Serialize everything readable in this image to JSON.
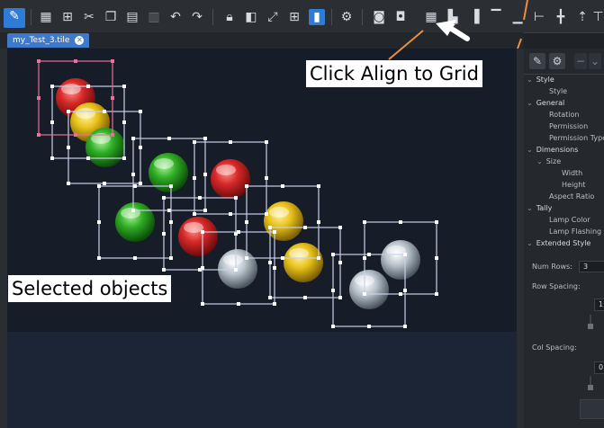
{
  "toolbar": {
    "tools": [
      "pen-edit-icon",
      "grid-large-icon",
      "grid-small-icon",
      "scissors-cut-icon",
      "copy-icon",
      "paste-icon",
      "delete-icon",
      "undo-icon",
      "redo-icon",
      "lock-icon",
      "unlock-icon",
      "resize-icon",
      "table-grid-icon",
      "align-bar-icon",
      "gear-icon",
      "snapshot-icon",
      "snapshot-alt-icon",
      "align-to-grid-icon",
      "align-bottom-left-icon",
      "align-right-icon",
      "align-top-icon",
      "align-bottom-icon",
      "distribute-horizontal-icon",
      "align-upload-icon",
      "distribute-icon"
    ]
  },
  "tab": {
    "label": "my_Test_3.tile",
    "close_icon": "close-icon"
  },
  "panel": {
    "tree": [
      {
        "label": "Style",
        "level": 0,
        "expanded": true
      },
      {
        "label": "Style",
        "level": 1
      },
      {
        "label": "General",
        "level": 0,
        "expanded": true
      },
      {
        "label": "Rotation",
        "level": 1
      },
      {
        "label": "Permission",
        "level": 1
      },
      {
        "label": "Permission Type",
        "level": 1
      },
      {
        "label": "Dimensions",
        "level": 0,
        "expanded": true
      },
      {
        "label": "Size",
        "level": 1,
        "expanded": true
      },
      {
        "label": "Width",
        "level": 2
      },
      {
        "label": "Height",
        "level": 2
      },
      {
        "label": "Aspect Ratio",
        "level": 1
      },
      {
        "label": "Tally",
        "level": 0,
        "expanded": true
      },
      {
        "label": "Lamp Color",
        "level": 1
      },
      {
        "label": "Lamp Flashing",
        "level": 1
      },
      {
        "label": "Extended Style",
        "level": 0,
        "expanded": true
      }
    ],
    "num_rows_label": "Num Rows:",
    "num_rows_value": "3",
    "row_spacing_label": "Row Spacing:",
    "row_spacing_value": "1",
    "col_spacing_label": "Col Spacing:",
    "col_spacing_value": "0"
  },
  "annotations": {
    "align_grid": "Click Align to Grid",
    "selected": "Selected objects"
  },
  "lamps": [
    {
      "color": "red"
    },
    {
      "color": "yellow"
    },
    {
      "color": "green"
    },
    {
      "color": "green"
    },
    {
      "color": "red"
    },
    {
      "color": "green"
    },
    {
      "color": "red"
    },
    {
      "color": "yellow"
    },
    {
      "color": "silver"
    },
    {
      "color": "yellow"
    },
    {
      "color": "silver"
    },
    {
      "color": "silver"
    }
  ],
  "colors": {
    "accent": "#2f7bd8",
    "red": "#d62828",
    "yellow": "#e8c21a",
    "green": "#2fae24",
    "silver": "#b9c3cc",
    "selection": "#c9cfe8",
    "primary_selection": "#e8709a",
    "callout_line": "#e89040"
  }
}
